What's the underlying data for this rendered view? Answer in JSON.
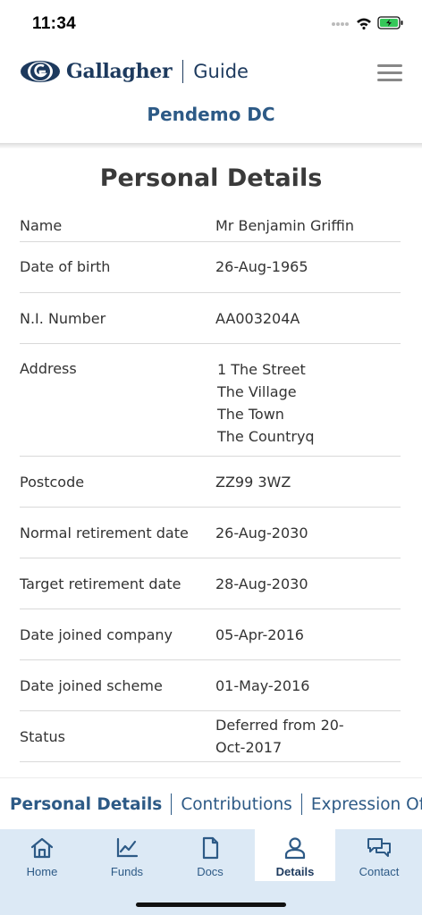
{
  "status_bar": {
    "time": "11:34"
  },
  "header": {
    "brand": "Gallagher",
    "product": "Guide",
    "scheme_title": "Pendemo DC"
  },
  "page": {
    "title": "Personal Details",
    "rows": [
      {
        "label": "Name",
        "value": "Mr Benjamin Griffin"
      },
      {
        "label": "Date of birth",
        "value": "26-Aug-1965"
      },
      {
        "label": "N.I. Number",
        "value": "AA003204A"
      },
      {
        "label": "Address",
        "value_lines": [
          "1 The Street",
          "The Village",
          "The Town",
          "The Countryq"
        ]
      },
      {
        "label": "Postcode",
        "value": "ZZ99 3WZ"
      },
      {
        "label": "Normal retirement date",
        "value": "26-Aug-2030"
      },
      {
        "label": "Target retirement date",
        "value": "28-Aug-2030"
      },
      {
        "label": "Date joined company",
        "value": "05-Apr-2016"
      },
      {
        "label": "Date joined scheme",
        "value": "01-May-2016"
      },
      {
        "label": "Status",
        "value_lines": [
          "Deferred from 20-",
          "Oct-2017"
        ]
      }
    ]
  },
  "tabs": [
    {
      "label": "Personal Details",
      "active": true
    },
    {
      "label": "Contributions",
      "active": false
    },
    {
      "label": "Expression Of Wishes",
      "active": false
    }
  ],
  "bottom_nav": [
    {
      "label": "Home",
      "icon": "home-icon"
    },
    {
      "label": "Funds",
      "icon": "chart-icon"
    },
    {
      "label": "Docs",
      "icon": "document-icon"
    },
    {
      "label": "Details",
      "icon": "user-icon",
      "active": true
    },
    {
      "label": "Contact",
      "icon": "chat-icon"
    }
  ],
  "colors": {
    "brand": "#1d3a5e",
    "accent": "#2d5a86",
    "nav_bg": "#dce9f5"
  }
}
